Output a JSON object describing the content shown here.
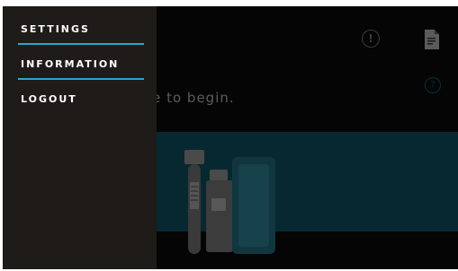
{
  "menu": {
    "items": [
      {
        "label": "SETTINGS"
      },
      {
        "label": "INFORMATION"
      },
      {
        "label": "LOGOUT"
      }
    ]
  },
  "main": {
    "prompt_visible": "le code to begin."
  },
  "icons": {
    "alert": "exclamation-circle-icon",
    "document": "document-icon",
    "help": "question-circle-icon"
  },
  "colors": {
    "accent": "#29a8c9",
    "drawer_bg": "#1f1b18",
    "panel_bg": "#072830"
  }
}
